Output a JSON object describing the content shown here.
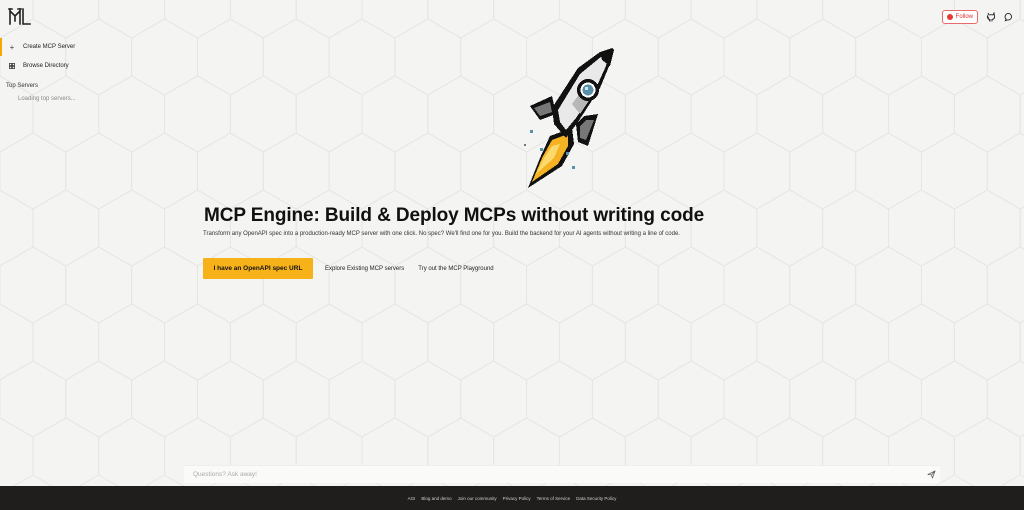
{
  "header": {
    "follow_label": "Follow"
  },
  "sidebar": {
    "items": [
      {
        "label": "Create MCP Server",
        "icon": "plus-icon"
      },
      {
        "label": "Browse Directory",
        "icon": "grid-icon"
      }
    ],
    "section_title": "Top Servers",
    "loading_text": "Loading top servers..."
  },
  "hero": {
    "title": "MCP Engine: Build & Deploy MCPs without writing code",
    "subtitle": "Transform any OpenAPI spec into a production-ready MCP server with one click. No spec? We'll find one for you. Build the backend for your AI agents without writing a line of code.",
    "primary_button": "I have an OpenAPI spec URL",
    "link_1": "Explore Existing MCP servers",
    "link_2": "Try out the MCP Playground"
  },
  "ask": {
    "placeholder": "Questions? Ask away!"
  },
  "footer": {
    "links": [
      "AGI",
      "Blog and demo",
      "Join our community",
      "Privacy Policy",
      "Terms of Service",
      "Data Security Policy"
    ]
  },
  "colors": {
    "accent": "#f7b21a",
    "background": "#f4f4f2",
    "footer": "#1f1e1c"
  }
}
